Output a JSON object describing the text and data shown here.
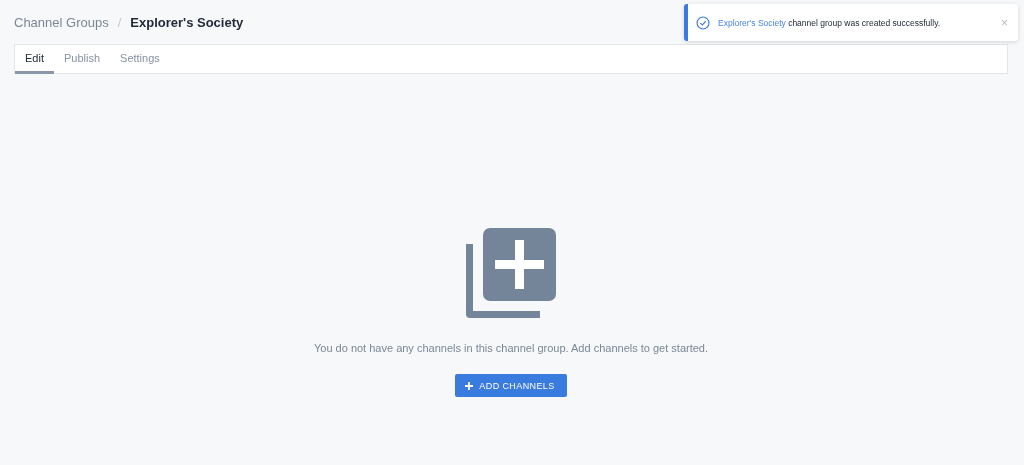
{
  "breadcrumb": [
    {
      "label": "Channel Groups",
      "current": false
    },
    {
      "label": "Explorer's Society",
      "current": true
    }
  ],
  "separator": "/",
  "tabs": [
    {
      "label": "Edit",
      "selected": true
    },
    {
      "label": "Publish",
      "selected": false
    },
    {
      "label": "Settings",
      "selected": false
    }
  ],
  "empty_state": {
    "message": "You do not have any channels in this channel group. Add channels to get started.",
    "button": "ADD CHANNELS"
  },
  "toast": {
    "link": "Explorer's Society",
    "message": "channel group was created successfully.",
    "close": "×"
  }
}
